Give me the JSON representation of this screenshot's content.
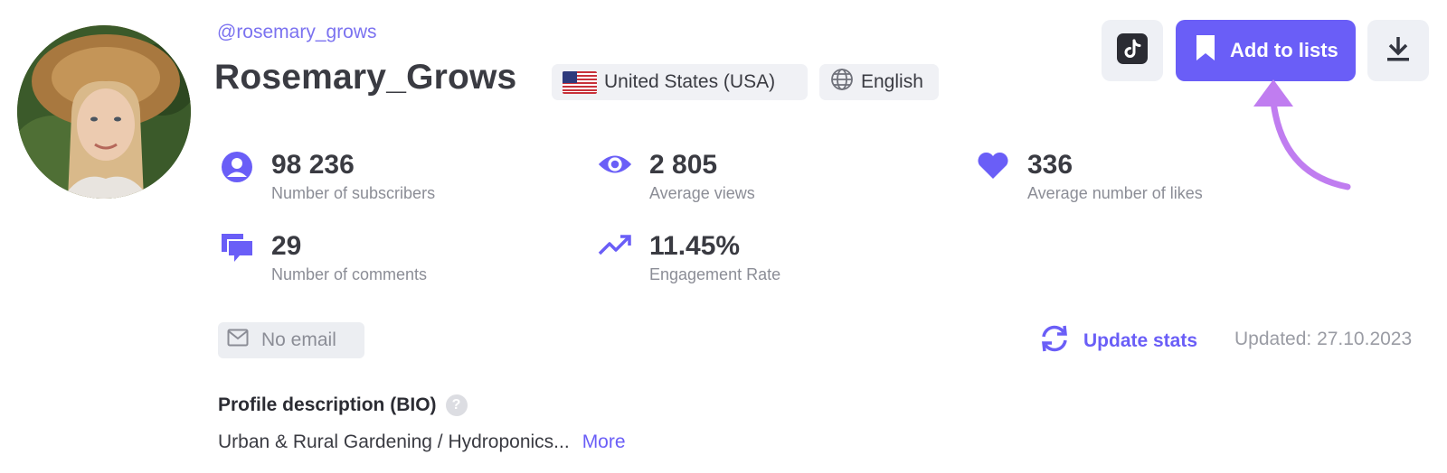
{
  "profile": {
    "handle": "@rosemary_grows",
    "name": "Rosemary_Grows",
    "country": "United States (USA)",
    "language": "English",
    "avatar_icon": "avatar-photo"
  },
  "actions": {
    "tiktok_icon": "tiktok-icon",
    "add_to_lists_label": "Add to lists",
    "download_icon": "download-icon"
  },
  "stats": [
    {
      "value": "98 236",
      "label": "Number of subscribers",
      "icon": "user-circle-icon"
    },
    {
      "value": "2 805",
      "label": "Average views",
      "icon": "eye-icon"
    },
    {
      "value": "336",
      "label": "Average number of likes",
      "icon": "heart-icon"
    },
    {
      "value": "29",
      "label": "Number of comments",
      "icon": "comments-icon"
    },
    {
      "value": "11.45%",
      "label": "Engagement Rate",
      "icon": "trending-up-icon"
    }
  ],
  "contact": {
    "email_label": "No email"
  },
  "update": {
    "label": "Update stats",
    "updated_text": "Updated: 27.10.2023"
  },
  "bio": {
    "title": "Profile description (BIO)",
    "help": "?",
    "text": "Urban & Rural Gardening / Hydroponics...",
    "more": "More"
  },
  "colors": {
    "accent": "#6a5ef7",
    "accent_light": "#7b72f0",
    "arrow": "#c07df0",
    "chip_bg": "#f0f1f5",
    "muted_text": "#8b8d96"
  }
}
